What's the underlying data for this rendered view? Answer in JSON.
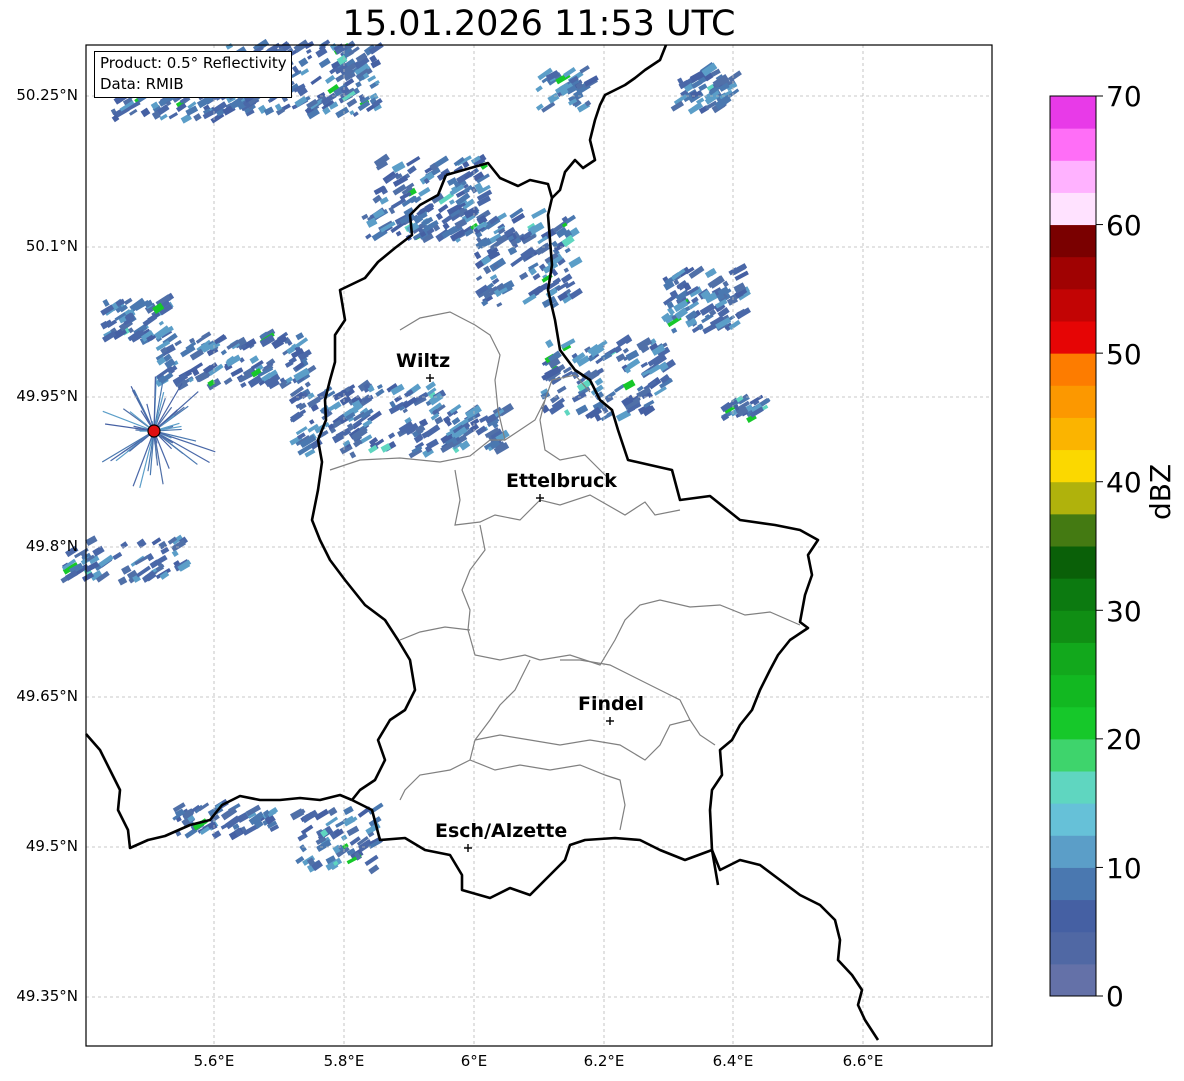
{
  "title": "15.01.2026 11:53 UTC",
  "info": {
    "product": "Product: 0.5° Reflectivity",
    "data": "Data: RMIB"
  },
  "lat_ticks": [
    "50.25°N",
    "50.1°N",
    "49.95°N",
    "49.8°N",
    "49.65°N",
    "49.5°N",
    "49.35°N"
  ],
  "lon_ticks": [
    "5.6°E",
    "5.8°E",
    "6°E",
    "6.2°E",
    "6.4°E",
    "6.6°E"
  ],
  "cities": [
    {
      "name": "Wiltz"
    },
    {
      "name": "Ettelbruck"
    },
    {
      "name": "Findel"
    },
    {
      "name": "Esch/Alzette"
    }
  ],
  "colorbar": {
    "label": "dBZ",
    "ticks": [
      "0",
      "10",
      "20",
      "30",
      "40",
      "50",
      "60",
      "70"
    ],
    "min": 0,
    "max": 70,
    "colors": [
      "#6471a8",
      "#5068a4",
      "#4560a3",
      "#4a78b0",
      "#5b9ec8",
      "#66c1d8",
      "#5fd6c0",
      "#3ed46c",
      "#16c82a",
      "#12b821",
      "#12a81c",
      "#108e14",
      "#0c7a10",
      "#0a6008",
      "#447a12",
      "#b0b20c",
      "#fbd800",
      "#fbb400",
      "#fc9800",
      "#fd7c00",
      "#e60505",
      "#c20404",
      "#a00202",
      "#7a0000",
      "#ffe2ff",
      "#ffb2ff",
      "#ff6ef7",
      "#e83ae8"
    ]
  },
  "colors": {
    "border": "#000000",
    "canton_lines": "#808080",
    "grid": "#b8b8b8",
    "radar_site": "#e01010"
  },
  "radar_site_icon": "radar-site-marker"
}
